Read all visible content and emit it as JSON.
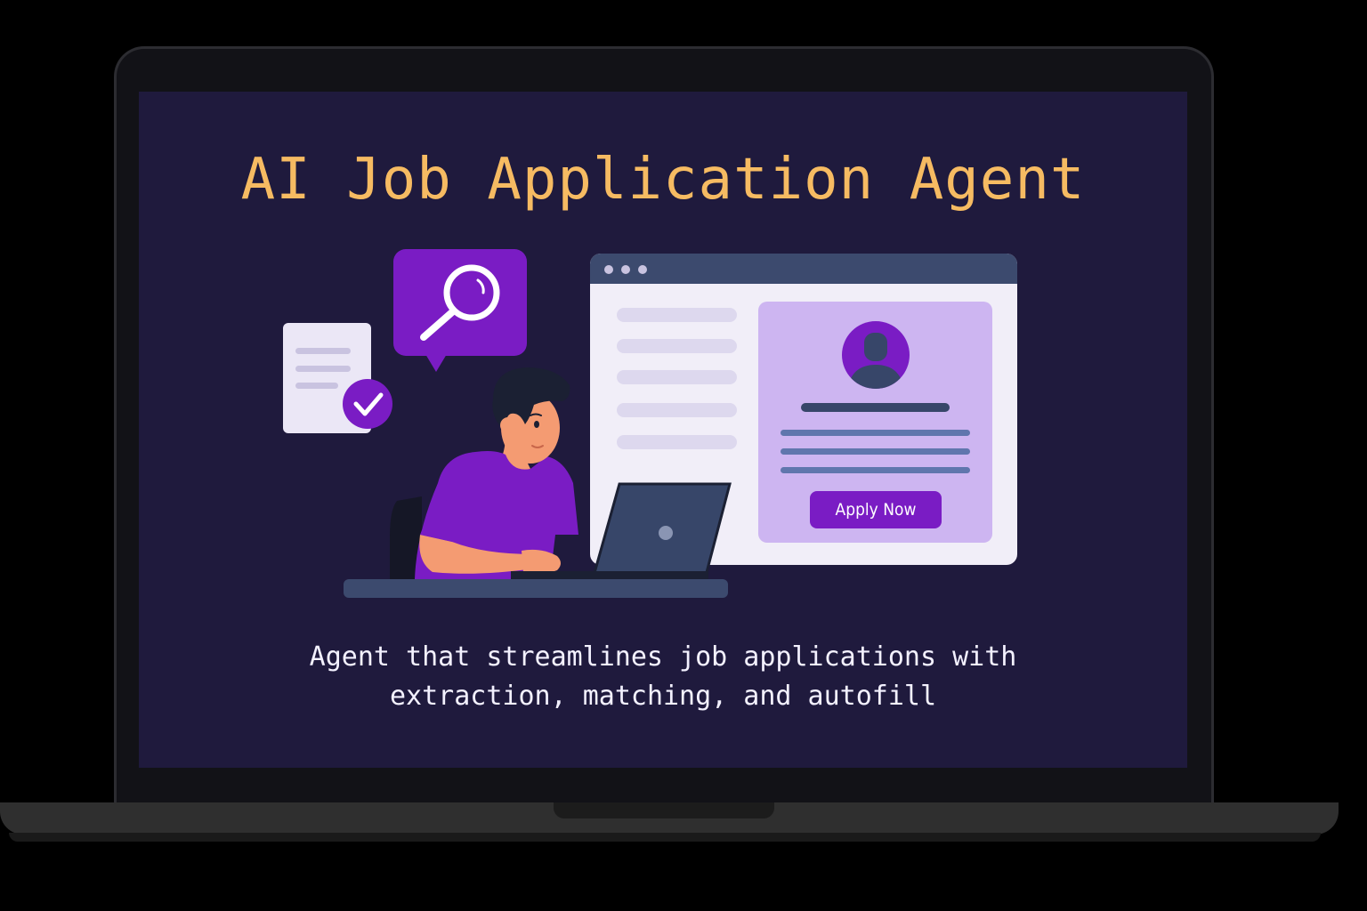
{
  "title": "AI Job Application Agent",
  "tagline": {
    "line1": "Agent that streamlines job applications with",
    "line2": "extraction, matching, and autofill"
  },
  "job_card": {
    "apply_label": "Apply Now"
  },
  "icons": {
    "search": "magnifying-glass-icon",
    "document_check": "checkmark-icon",
    "profile": "user-avatar-icon"
  },
  "colors": {
    "screen_background": "#1f1a3d",
    "title": "#f6bb62",
    "accent_purple": "#7a1cc4",
    "card_lavender": "#cdb5f1",
    "browser_bar": "#3c4a6e"
  }
}
